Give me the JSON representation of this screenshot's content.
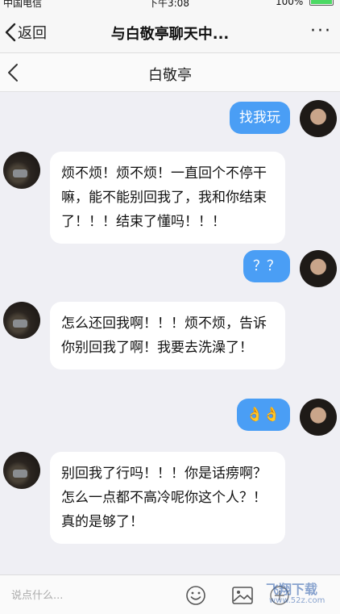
{
  "status_bar": {
    "carrier": "中国电信",
    "time": "下午3:08",
    "battery": "100%"
  },
  "nav": {
    "back_label": "返回",
    "title": "与白敬亭聊天中...",
    "more": "···"
  },
  "chat": {
    "title": "白敬亭"
  },
  "messages": [
    {
      "side": "me",
      "text": "找我玩"
    },
    {
      "side": "other",
      "text": "烦不烦！烦不烦！一直回个不停干嘛，能不能别回我了，我和你结束了！！！结束了懂吗！！！"
    },
    {
      "side": "me",
      "text": "？？"
    },
    {
      "side": "other",
      "text": "怎么还回我啊！！！烦不烦，告诉你别回我了啊！我要去洗澡了！"
    },
    {
      "side": "me",
      "text": "👌👌"
    },
    {
      "side": "other",
      "text": "别回我了行吗！！！你是话痨啊？怎么一点都不高冷呢你这个人？！真的是够了！"
    }
  ],
  "input": {
    "placeholder": "说点什么..."
  },
  "watermark": {
    "title": "飞翔下载",
    "url": "www.52z.com"
  }
}
